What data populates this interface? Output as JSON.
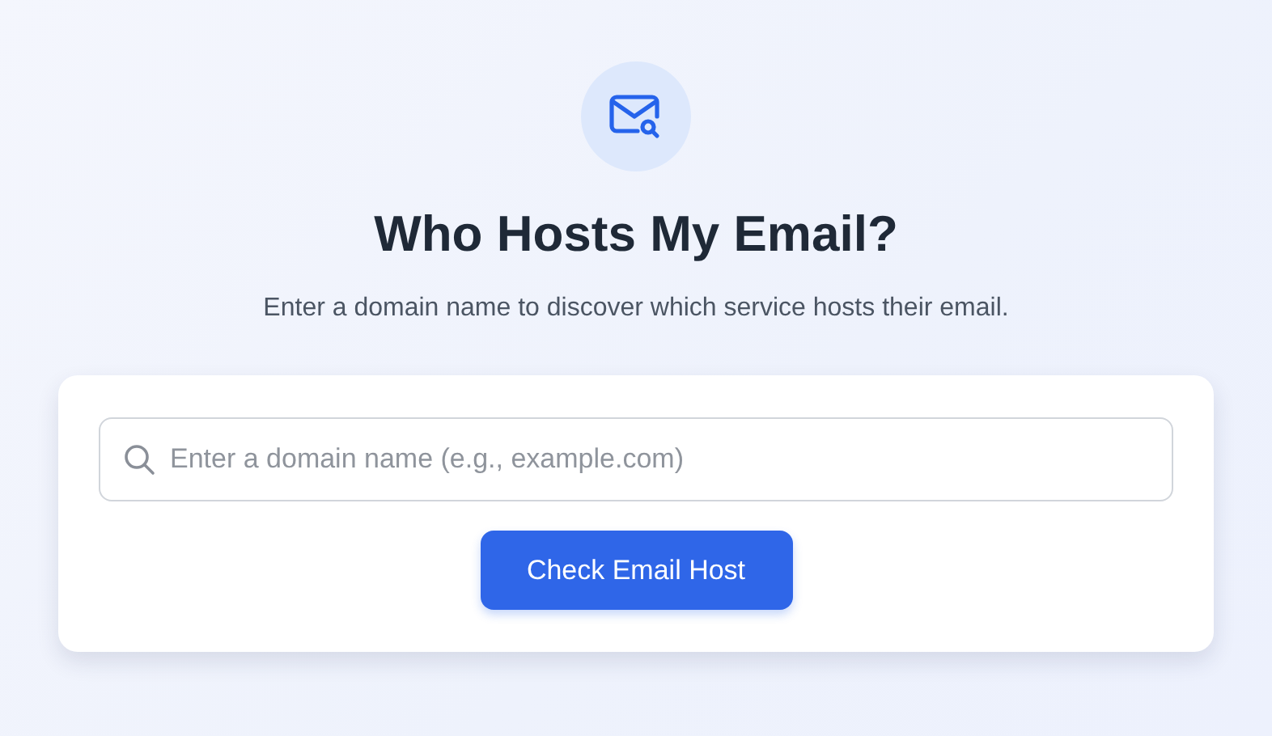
{
  "header": {
    "title": "Who Hosts My Email?",
    "subtitle": "Enter a domain name to discover which service hosts their email."
  },
  "form": {
    "search": {
      "placeholder": "Enter a domain name (e.g., example.com)"
    },
    "button": "Check Email Host"
  }
}
